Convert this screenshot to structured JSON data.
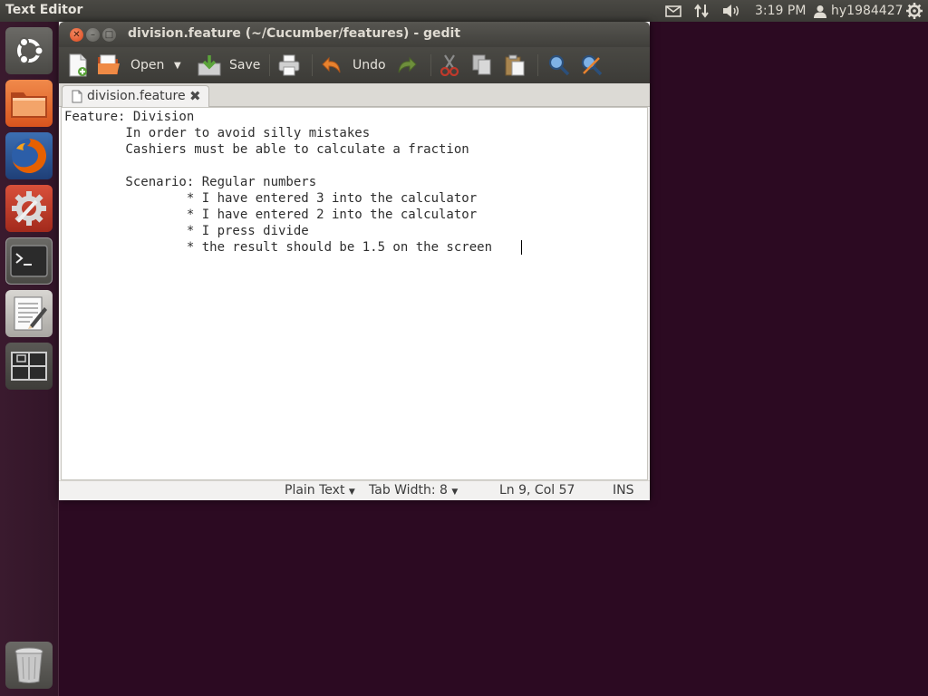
{
  "top_panel": {
    "app_title": "Text Editor",
    "clock": "3:19 PM",
    "user": "hy1984427",
    "icons": [
      "mail-icon",
      "network-icon",
      "volume-icon",
      "user-icon",
      "gear-icon"
    ]
  },
  "launcher": {
    "items": [
      "dash-home",
      "files",
      "firefox",
      "system-settings",
      "terminal",
      "text-editor",
      "workspace-switcher",
      "trash"
    ]
  },
  "window": {
    "title": "division.feature (~/Cucumber/features) - gedit",
    "toolbar": {
      "open_label": "Open",
      "save_label": "Save",
      "undo_label": "Undo"
    },
    "tab": {
      "label": "division.feature"
    },
    "editor": {
      "lines": [
        "Feature: Division",
        "        In order to avoid silly mistakes",
        "        Cashiers must be able to calculate a fraction",
        "",
        "        Scenario: Regular numbers",
        "                * I have entered 3 into the calculator",
        "                * I have entered 2 into the calculator",
        "                * I press divide",
        "                * the result should be 1.5 on the screen"
      ]
    },
    "statusbar": {
      "language": "Plain Text",
      "tab_width": "Tab Width:  8",
      "position": "Ln 9, Col 57",
      "mode": "INS"
    }
  },
  "colors": {
    "desktop": "#2c0a22",
    "panel": "#3b3a36",
    "close_button": "#e05a2a",
    "firefox_orange": "#e66000"
  }
}
